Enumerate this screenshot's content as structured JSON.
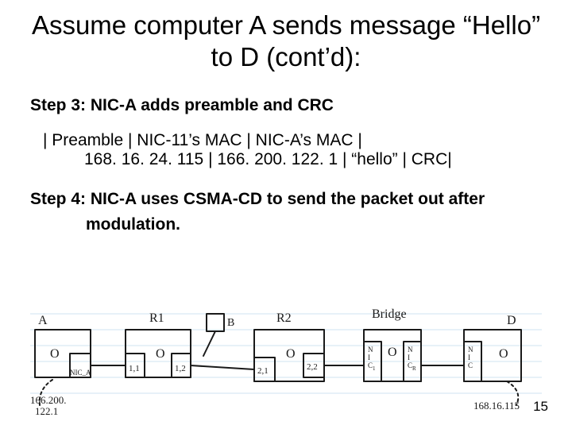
{
  "title": "Assume computer A sends message “Hello” to D (cont’d):",
  "step3": {
    "heading": "Step 3: NIC-A adds preamble and CRC",
    "line1": "| Preamble | NIC-11’s MAC | NIC-A’s MAC |",
    "line2": "168. 16. 24. 115 | 166. 200. 122. 1 | “hello” | CRC|"
  },
  "step4": {
    "line1": "Step 4: NIC-A uses CSMA-CD to send the packet out after",
    "line2": "modulation."
  },
  "diagram_labels": {
    "A": "A",
    "R1": "R1",
    "B": "B",
    "R2": "R2",
    "Bridge": "Bridge",
    "D": "D",
    "nicA": "NIC_A",
    "n11": "1,1",
    "n12": "1,2",
    "n21": "2,1",
    "n22": "2,2",
    "nicC1": "N\nI\nC₁",
    "nicCR": "N\nI\nCᵣ",
    "nicD": "N\nI\nC",
    "o": "O",
    "ipA": "166.200.\n122.1",
    "ipD": "168.16.115"
  },
  "page_number": "15"
}
